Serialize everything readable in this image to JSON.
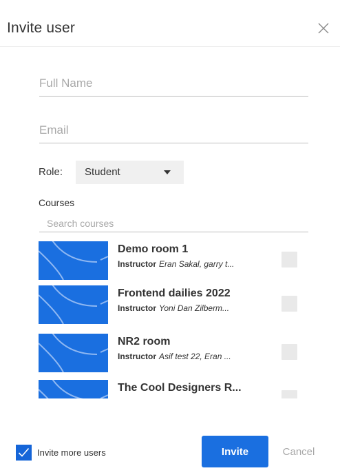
{
  "dialog": {
    "title": "Invite user"
  },
  "form": {
    "full_name_placeholder": "Full Name",
    "full_name_value": "",
    "email_placeholder": "Email",
    "email_value": "",
    "role_label": "Role:",
    "role_selected": "Student",
    "courses_label": "Courses",
    "search_placeholder": "Search courses"
  },
  "courses": [
    {
      "name": "Demo room 1",
      "instructor_label": "Instructor",
      "instructors": "Eran Sakal, garry t...",
      "checked": false
    },
    {
      "name": "Frontend dailies 2022",
      "instructor_label": "Instructor",
      "instructors": "Yoni Dan Zilberm...",
      "checked": false
    },
    {
      "name": "NR2 room",
      "instructor_label": "Instructor",
      "instructors": "Asif test 22, Eran ...",
      "checked": false
    },
    {
      "name": "The Cool Designers R...",
      "instructor_label": "",
      "instructors": "",
      "checked": false
    }
  ],
  "footer": {
    "invite_more_label": "Invite more users",
    "invite_more_checked": true,
    "invite_label": "Invite",
    "cancel_label": "Cancel"
  },
  "colors": {
    "accent": "#1a6fe0",
    "thumb": "#1a6fe0",
    "checkbox_empty": "#e9e9e9"
  },
  "icons": {
    "close": "close-icon",
    "caret": "caret-down-icon",
    "check": "checkmark-icon"
  }
}
